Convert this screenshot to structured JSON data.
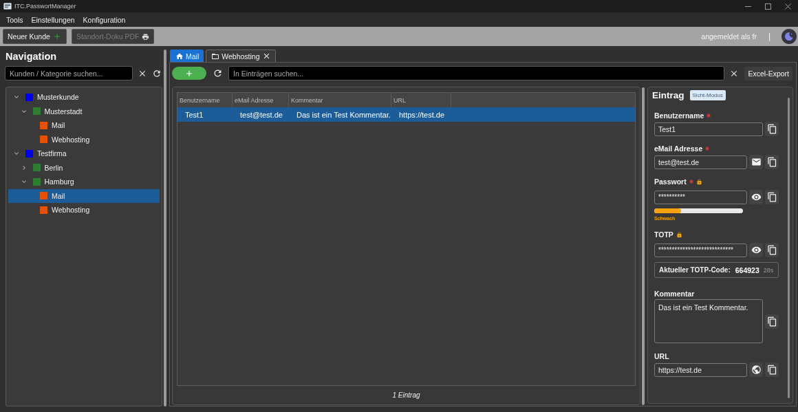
{
  "window": {
    "title": "ITC.PasswortManager"
  },
  "menu": [
    "Tools",
    "Einstellungen",
    "Konfiguration"
  ],
  "toolbar": {
    "buttons": [
      {
        "label": "Neuer Kunde",
        "disabled": false
      },
      {
        "label": "Standort-Doku PDF",
        "disabled": true
      }
    ],
    "user_label": "angemeldet als fr",
    "separator": "|"
  },
  "navigation": {
    "title": "Navigation",
    "search": {
      "placeholder": "Kunden / Kategorie suchen..."
    },
    "tree": [
      {
        "label": "Musterkunde",
        "color": "#0000ee",
        "expanded": true,
        "selected": false,
        "children": [
          {
            "label": "Musterstadt",
            "color": "#2e7d32",
            "expanded": true,
            "selected": false,
            "children": [
              {
                "label": "Mail",
                "color": "#e65100",
                "selected": false
              },
              {
                "label": "Webhosting",
                "color": "#e65100",
                "selected": false
              }
            ]
          }
        ]
      },
      {
        "label": "Testfirma",
        "color": "#0000ee",
        "expanded": true,
        "selected": false,
        "children": [
          {
            "label": "Berlin",
            "color": "#2e7d32",
            "expanded": false,
            "selected": false
          },
          {
            "label": "Hamburg",
            "color": "#2e7d32",
            "expanded": true,
            "selected": false,
            "children": [
              {
                "label": "Mail",
                "color": "#e65100",
                "selected": true
              },
              {
                "label": "Webhosting",
                "color": "#e65100",
                "selected": false
              }
            ]
          }
        ]
      }
    ]
  },
  "tabs": [
    {
      "label": "Mail",
      "closable": false,
      "selected": true
    },
    {
      "label": "Webhosting",
      "closable": true,
      "selected": false
    }
  ],
  "entries": {
    "search": {
      "placeholder": "In Einträgen suchen..."
    },
    "export_button": "Excel-Export",
    "table": {
      "columns": [
        "Benutzername",
        "eMail Adresse",
        "Kommentar",
        "URL"
      ],
      "rows": [
        {
          "cells": [
            "Test1",
            "test@test.de",
            "Das ist ein Test Kommentar.",
            "https://test.de"
          ],
          "selected": true
        }
      ]
    },
    "footer": "1 Eintrag"
  },
  "detail": {
    "title": "Eintrag",
    "mode_badge": "Sicht-Modus",
    "fields": [
      {
        "kind": "text",
        "label": "Benutzername",
        "required": true,
        "locked": false,
        "value": "Test1"
      },
      {
        "kind": "email",
        "label": "eMail Adresse",
        "required": true,
        "locked": false,
        "value": "test@test.de"
      },
      {
        "kind": "password",
        "label": "Passwort",
        "required": true,
        "locked": true,
        "value": "**********",
        "strength": {
          "level": 0.3,
          "label": "Schwach"
        }
      },
      {
        "kind": "password",
        "label": "TOTP",
        "required": false,
        "locked": true,
        "value": "****************************"
      },
      {
        "kind": "totp_code",
        "label": "Aktueller TOTP-Code:",
        "code": "664923",
        "remaining": "28s"
      },
      {
        "kind": "textarea",
        "label": "Kommentar",
        "required": false,
        "locked": false,
        "value": "Das ist ein Test Kommentar."
      },
      {
        "kind": "url",
        "label": "URL",
        "required": false,
        "locked": false,
        "value": "https://test.de"
      }
    ]
  }
}
